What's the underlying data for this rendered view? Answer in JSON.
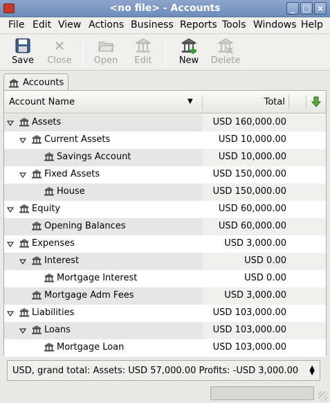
{
  "window": {
    "title": "<no file> - Accounts"
  },
  "menubar": [
    {
      "label": "File"
    },
    {
      "label": "Edit"
    },
    {
      "label": "View"
    },
    {
      "label": "Actions"
    },
    {
      "label": "Business"
    },
    {
      "label": "Reports"
    },
    {
      "label": "Tools"
    },
    {
      "label": "Windows"
    },
    {
      "label": "Help"
    }
  ],
  "toolbar": {
    "save": "Save",
    "close": "Close",
    "open": "Open",
    "edit": "Edit",
    "new": "New",
    "delete": "Delete"
  },
  "tab": {
    "label": "Accounts"
  },
  "columns": {
    "name": "Account Name",
    "total": "Total"
  },
  "accounts": [
    {
      "name": "Assets",
      "total": "USD 160,000.00",
      "depth": 0,
      "expander": "expanded"
    },
    {
      "name": "Current Assets",
      "total": "USD 10,000.00",
      "depth": 1,
      "expander": "expanded"
    },
    {
      "name": "Savings Account",
      "total": "USD 10,000.00",
      "depth": 2,
      "expander": "none"
    },
    {
      "name": "Fixed Assets",
      "total": "USD 150,000.00",
      "depth": 1,
      "expander": "expanded"
    },
    {
      "name": "House",
      "total": "USD 150,000.00",
      "depth": 2,
      "expander": "none"
    },
    {
      "name": "Equity",
      "total": "USD 60,000.00",
      "depth": 0,
      "expander": "expanded"
    },
    {
      "name": "Opening Balances",
      "total": "USD 60,000.00",
      "depth": 1,
      "expander": "none"
    },
    {
      "name": "Expenses",
      "total": "USD 3,000.00",
      "depth": 0,
      "expander": "expanded"
    },
    {
      "name": "Interest",
      "total": "USD 0.00",
      "depth": 1,
      "expander": "expanded"
    },
    {
      "name": "Mortgage Interest",
      "total": "USD 0.00",
      "depth": 2,
      "expander": "none"
    },
    {
      "name": "Mortgage Adm Fees",
      "total": "USD 3,000.00",
      "depth": 1,
      "expander": "none"
    },
    {
      "name": "Liabilities",
      "total": "USD 103,000.00",
      "depth": 0,
      "expander": "expanded"
    },
    {
      "name": "Loans",
      "total": "USD 103,000.00",
      "depth": 1,
      "expander": "expanded"
    },
    {
      "name": "Mortgage Loan",
      "total": "USD 103,000.00",
      "depth": 2,
      "expander": "none"
    }
  ],
  "summary": {
    "text": "USD, grand total:  Assets: USD 57,000.00  Profits: -USD 3,000.00"
  },
  "colors": {
    "titlebar": "#7a96c2",
    "new_icon_plus": "#2f9a2f",
    "arrow": "#3c8c2c"
  }
}
